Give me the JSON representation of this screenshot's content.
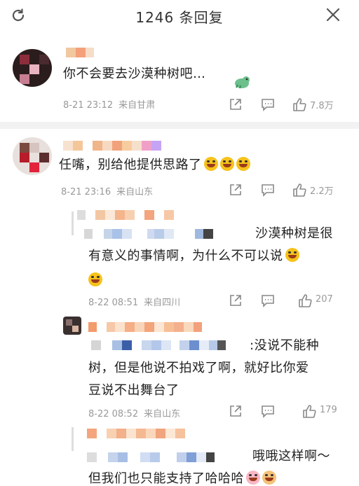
{
  "header": {
    "title": "1246 条回复",
    "refresh_icon": "refresh-icon",
    "close_icon": "close-icon"
  },
  "comments": [
    {
      "text": "你不会要去沙漠种树吧…",
      "time": "8-21 23:12",
      "location": "来自甘肃",
      "likes": "7.8万"
    },
    {
      "text": "任嘴，别给他提供思路了",
      "time": "8-21 23:16",
      "location": "来自山东",
      "likes": "2.2万"
    }
  ],
  "replies": [
    {
      "line1": "沙漠种树是很",
      "line2": "有意义的事情啊，为什么不可以说",
      "time": "8-22 08:51",
      "location": "来自四川",
      "likes": "207"
    },
    {
      "line1": ":没说不能种",
      "line2": "树，但是他说不拍戏了啊，就好比你爱",
      "line3": "豆说不出舞台了",
      "time": "8-22 08:52",
      "location": "来自山东",
      "likes": "179"
    },
    {
      "line1": "哦哦这样啊～",
      "line2": "但我们也只能支持了哈哈哈"
    }
  ],
  "colors": {
    "text": "#222222",
    "meta": "#999999",
    "separator": "#f2f2f2",
    "accent_emoji": "#f6c21b"
  }
}
